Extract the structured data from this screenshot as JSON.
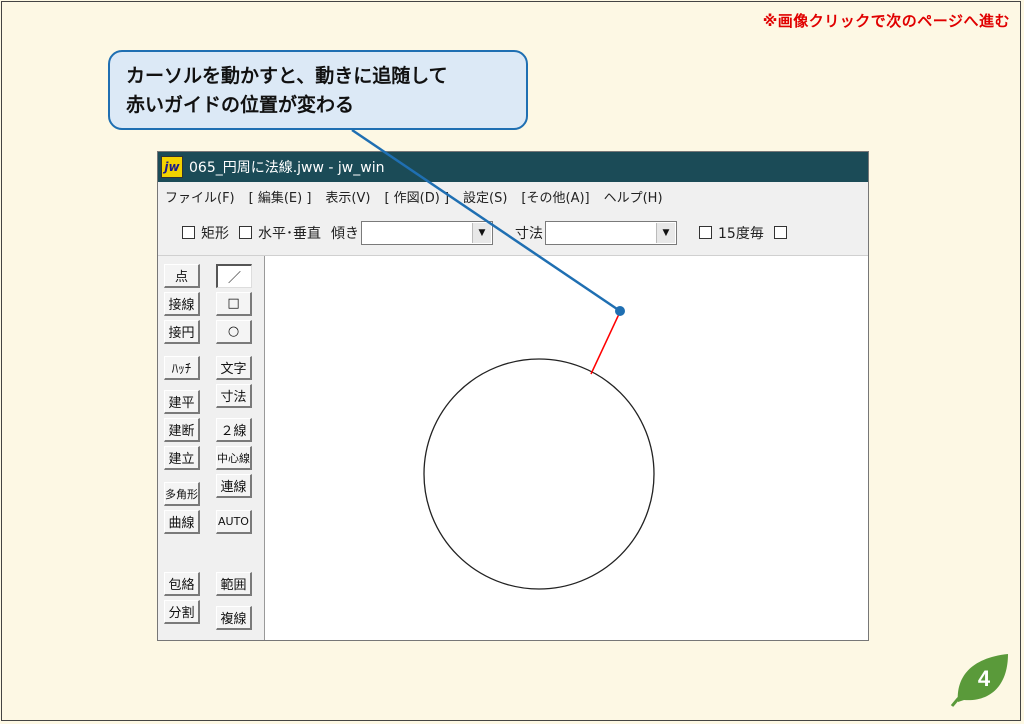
{
  "page": {
    "nav_note": "※画像クリックで次のページへ進む",
    "page_number": "4"
  },
  "callout": {
    "line1": "カーソルを動かすと、動きに追随して",
    "line2": "赤いガイドの位置が変わる"
  },
  "window": {
    "icon_text": "jw",
    "title": "065_円周に法線.jww - jw_win"
  },
  "menu": [
    "ファイル(F)",
    "[ 編集(E) ]",
    "表示(V)",
    "[ 作図(D) ]",
    "設定(S)",
    "[その他(A)]",
    "ヘルプ(H)"
  ],
  "toolbar": {
    "rect_label": "矩形",
    "hv_label": "水平･垂直",
    "slope_label": "傾き",
    "slope_value": "",
    "dim_label": "寸法",
    "dim_value": "",
    "deg_label": "15度毎"
  },
  "tools": {
    "left": [
      "点",
      "接線",
      "接円",
      "ﾊｯﾁ",
      "建平",
      "建断",
      "建立",
      "多角形",
      "曲線",
      "包絡",
      "分割"
    ],
    "right": [
      "／",
      "□",
      "○",
      "文字",
      "寸法",
      "２線",
      "中心線",
      "連線",
      "AUTO",
      "範囲",
      "複線"
    ]
  },
  "colors": {
    "guide_line": "#ff0000",
    "callout_border": "#1f6fb2",
    "titlebar": "#1b4b57",
    "leaf": "#5a9a3a"
  }
}
